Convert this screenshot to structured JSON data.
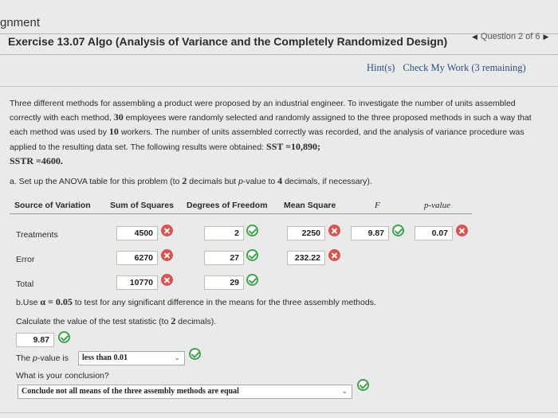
{
  "header": {
    "partial_title": "gnment",
    "exercise_title": "Exercise 13.07 Algo (Analysis of Variance and the Completely Randomized Design)",
    "question_nav": "Question 2 of 6",
    "prev_icon": "triangle-left-icon",
    "next_icon": "triangle-right-icon"
  },
  "links": {
    "hints": "Hint(s)",
    "check": "Check My Work (3 remaining)"
  },
  "problem": {
    "p1": "Three different methods for assembling a product were proposed by an industrial engineer. To investigate the number of units assembled correctly with each method, ",
    "n_emp": "30",
    "p2": " employees were randomly selected and randomly assigned to the three proposed methods in such a way that each method was used by ",
    "n_workers": "10",
    "p3": " workers. The number of units assembled correctly was recorded, and the analysis of variance procedure was applied to the resulting data set. The following results were obtained: ",
    "sst": "SST =10,890;",
    "sstr": "SSTR =4600."
  },
  "part_a": {
    "p1": "a. Set up the ANOVA table for this problem (to ",
    "n1": "2",
    "p2": " decimals but ",
    "p3": "p",
    "p4": "-value to ",
    "n2": "4",
    "p5": " decimals, if necessary)."
  },
  "table": {
    "headers": {
      "source": "Source of Variation",
      "ss": "Sum of Squares",
      "df": "Degrees of Freedom",
      "ms": "Mean Square",
      "f": "F",
      "pval": "p-value"
    },
    "treatments": {
      "label": "Treatments",
      "ss": "4500",
      "df": "2",
      "ms": "2250",
      "f": "9.87",
      "p": "0.07"
    },
    "error": {
      "label": "Error",
      "ss": "6270",
      "df": "27",
      "ms": "232.22"
    },
    "total": {
      "label": "Total",
      "ss": "10770",
      "df": "29"
    }
  },
  "part_b": {
    "p1": "b.Use ",
    "alpha": "α = 0.05",
    "p2": " to test for any significant difference in the means for the three assembly methods.",
    "calc1": "Calculate the value of the test statistic (to ",
    "calc_n": "2",
    "calc2": " decimals).",
    "stat_value": "9.87",
    "pv1": "The ",
    "pv2": "p",
    "pv3": "-value is",
    "pv_selected": "less than 0.01",
    "conclusion_q": "What is your conclusion?",
    "conclusion_selected": "Conclude not all means of the three assembly methods are equal"
  },
  "colors": {
    "link": "#2d4f82",
    "correct": "#3ea44a",
    "wrong": "#d9534f"
  }
}
